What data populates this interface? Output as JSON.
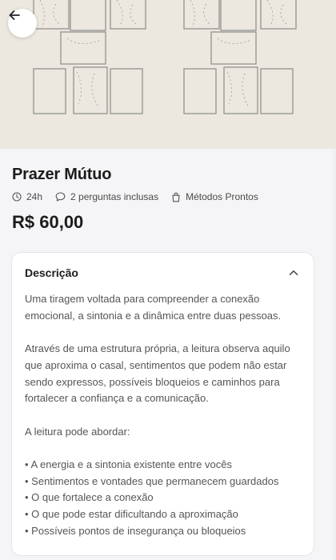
{
  "product": {
    "title": "Prazer Mútuo",
    "meta": [
      {
        "icon": "clock-icon",
        "label": "24h"
      },
      {
        "icon": "chat-bubble-icon",
        "label": "2 perguntas inclusas"
      },
      {
        "icon": "shopping-bag-icon",
        "label": "Métodos Prontos"
      }
    ],
    "price": "R$ 60,00"
  },
  "description": {
    "title": "Descrição",
    "expanded": true,
    "paragraphs": [
      "Uma tiragem voltada para compreender a conexão emocional, a sintonia e a dinâmica entre duas pessoas.",
      "Através de uma estrutura própria, a leitura observa aquilo que aproxima o casal, sentimentos que podem não estar sendo expressos, possíveis bloqueios e caminhos para fortalecer a confiança e a comunicação.",
      "A leitura pode abordar:"
    ],
    "bullets": [
      "• A energia e a sintonia existente entre vocês",
      "• Sentimentos e vontades que permanecem guardados",
      "• O que fortalece a conexão",
      "• O que pode estar dificultando a aproximação",
      "• Possíveis pontos de insegurança ou bloqueios"
    ]
  },
  "colors": {
    "background": "#f5f5f7",
    "card": "#ffffff",
    "text": "#1c1c1c",
    "muted": "#555555"
  }
}
